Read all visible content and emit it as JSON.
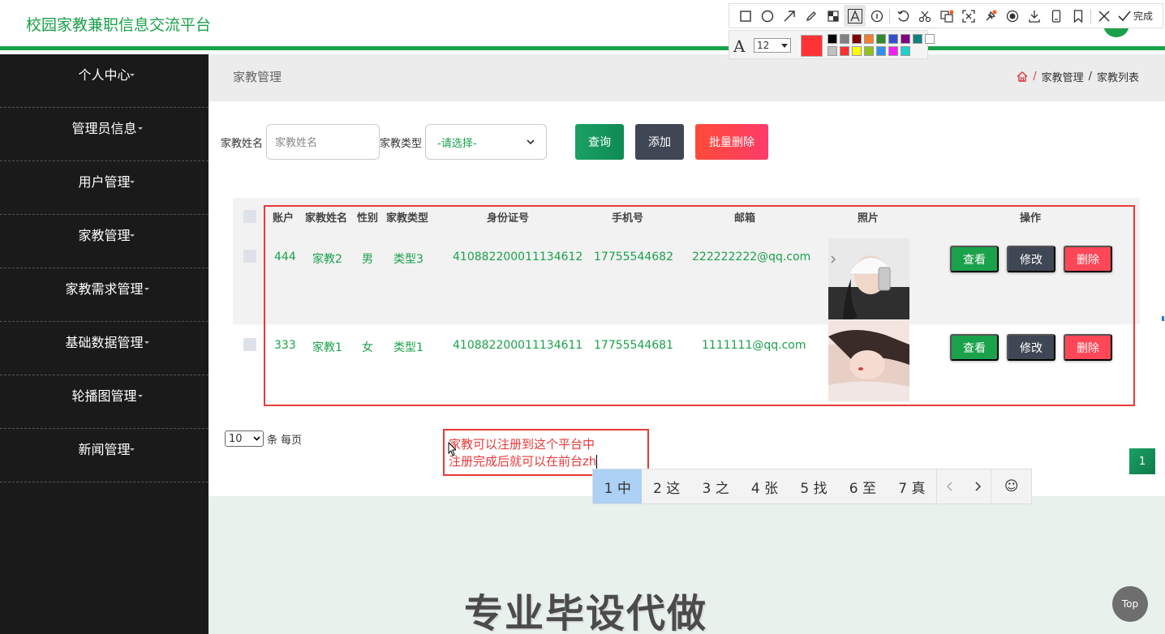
{
  "header": {
    "title": "校园家教兼职信息交流平台"
  },
  "sidebar": {
    "items": [
      {
        "label": "个人中心"
      },
      {
        "label": "管理员信息"
      },
      {
        "label": "用户管理"
      },
      {
        "label": "家教管理"
      },
      {
        "label": "家教需求管理"
      },
      {
        "label": "基础数据管理"
      },
      {
        "label": "轮播图管理"
      },
      {
        "label": "新闻管理"
      }
    ]
  },
  "page": {
    "title": "家教管理",
    "breadcrumb": [
      "家教管理",
      "家教列表"
    ],
    "breadcrumb_sep": "/"
  },
  "search": {
    "name_label": "家教姓名",
    "name_placeholder": "家教姓名",
    "type_label": "家教类型",
    "type_selected": "-请选择-",
    "query_label": "查询",
    "add_label": "添加",
    "batch_delete_label": "批量删除"
  },
  "table": {
    "headers": {
      "account": "账户",
      "name": "家教姓名",
      "gender": "性别",
      "type": "家教类型",
      "id_card": "身份证号",
      "phone": "手机号",
      "email": "邮箱",
      "photo": "照片",
      "actions": "操作"
    },
    "rows": [
      {
        "account": "444",
        "name": "家教2",
        "gender": "男",
        "type": "类型3",
        "id_card": "410882200011134612",
        "phone": "17755544682",
        "email": "222222222@qq.com"
      },
      {
        "account": "333",
        "name": "家教1",
        "gender": "女",
        "type": "类型1",
        "id_card": "410882200011134611",
        "phone": "17755544681",
        "email": "1111111@qq.com"
      }
    ],
    "view_label": "查看",
    "edit_label": "修改",
    "delete_label": "删除"
  },
  "pagination": {
    "page_size": "10",
    "page_size_suffix": "条 每页",
    "current_page": "1"
  },
  "footer": {
    "watermark": "专业毕设代做",
    "top_label": "Top"
  },
  "annotation": {
    "line1": "家教可以注册到这个平台中",
    "line2": "注册完成后就可以在前台zh"
  },
  "ime": {
    "candidates": [
      "1 中",
      "2 这",
      "3 之",
      "4 张",
      "5 找",
      "6 至",
      "7 真"
    ],
    "emoji": "☺"
  },
  "screenshot_tool": {
    "done_label": "完成",
    "font_size": "12",
    "current_color": "#ff3333",
    "palette": [
      "#000000",
      "#808080",
      "#800000",
      "#f08030",
      "#2e8b2e",
      "#3050d0",
      "#800080",
      "#108080",
      "#ffffff",
      "#c0c0c0",
      "#ff3030",
      "#ffff00",
      "#90c020",
      "#3090f0",
      "#f020f0",
      "#20d0d0"
    ]
  },
  "colors": {
    "brand_green": "#1aa14b",
    "sidebar_bg": "#1a1a1a",
    "danger": "#ff4757",
    "dark_btn": "#3f4654"
  }
}
